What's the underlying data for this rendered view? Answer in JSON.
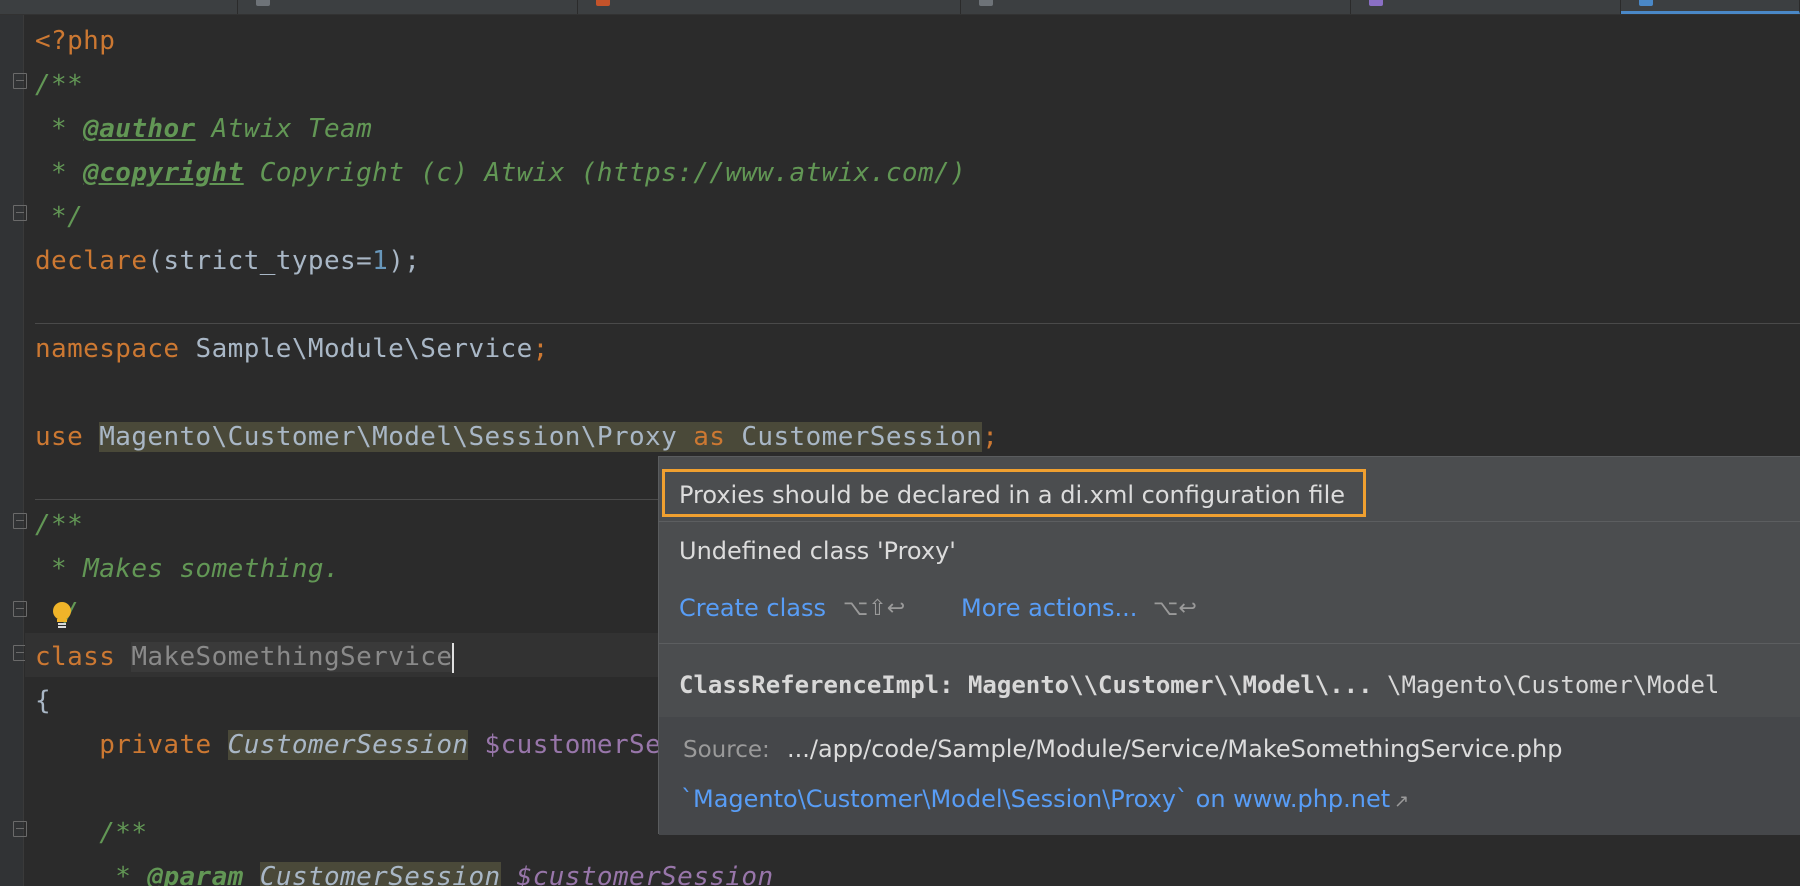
{
  "colors": {
    "keyword": "#cc7832",
    "comment": "#629755",
    "number": "#6897bb",
    "variable": "#9876aa",
    "link": "#589df6",
    "highlight_border": "#f0a030"
  },
  "code": {
    "l1": "<?php",
    "l2": "/**",
    "l3_a": " * ",
    "l3_tag": "@author",
    "l3_b": " Atwix Team",
    "l4_a": " * ",
    "l4_tag": "@copyright",
    "l4_b": " Copyright (c) Atwix (https://www.atwix.com/)",
    "l5": " */",
    "l6_kw": "declare",
    "l6_a": "(strict_types=",
    "l6_num": "1",
    "l6_b": ");",
    "l8_kw": "namespace",
    "l8_a": " Sample\\Module\\Service",
    "l8_b": ";",
    "l10_kw": "use",
    "l10_hl1": "Magento\\Customer\\Model\\Session\\Proxy ",
    "l10_as": "as",
    "l10_hl2": " CustomerSession",
    "l10_semi": ";",
    "l12": "/**",
    "l13": " * Makes something.",
    "l14": "/",
    "l15_kw": "class",
    "l15_name": "MakeSomethingService",
    "l16": "{",
    "l17_kw": "private",
    "l17_type": "CustomerSession",
    "l17_var": "$customerSe",
    "l19": "/**",
    "l20_a": " * ",
    "l20_tag": "@param",
    "l20_type": "CustomerSession",
    "l20_var": " $customerSession"
  },
  "popup": {
    "title": "Proxies should be declared in a di.xml configuration file",
    "message": "Undefined class 'Proxy'",
    "create_class": "Create class",
    "create_class_shortcut": "⌥⇧↩",
    "more_actions": "More actions...",
    "more_actions_shortcut": "⌥↩",
    "ref_bold": "ClassReferenceImpl: Magento\\\\Customer\\\\Model\\...",
    "ref_plain": " \\Magento\\Customer\\Model",
    "source_label": "Source:",
    "source_value": ".../app/code/Sample/Module/Service/MakeSomethingService.php",
    "doc_link": "`Magento\\Customer\\Model\\Session\\Proxy` on www.php.net",
    "doc_link_icon": "↗"
  }
}
